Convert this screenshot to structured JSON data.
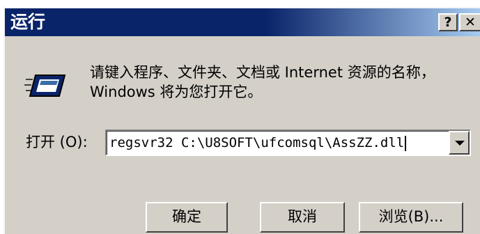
{
  "window": {
    "title": "运行",
    "help_label": "?",
    "close_label": "✕"
  },
  "description": "请键入程序、文件夹、文档或 Internet 资源的名称，Windows 将为您打开它。",
  "open_field": {
    "label": "打开 (O):",
    "value": "regsvr32 C:\\U8SOFT\\ufcomsql\\AssZZ.dll"
  },
  "buttons": {
    "ok": "确定",
    "cancel": "取消",
    "browse": "浏览(B)..."
  },
  "icons": {
    "run": "run-program-icon",
    "dropdown": "chevron-down-icon"
  },
  "colors": {
    "titlebar": "#0a246a",
    "face": "#d4d0c8"
  }
}
